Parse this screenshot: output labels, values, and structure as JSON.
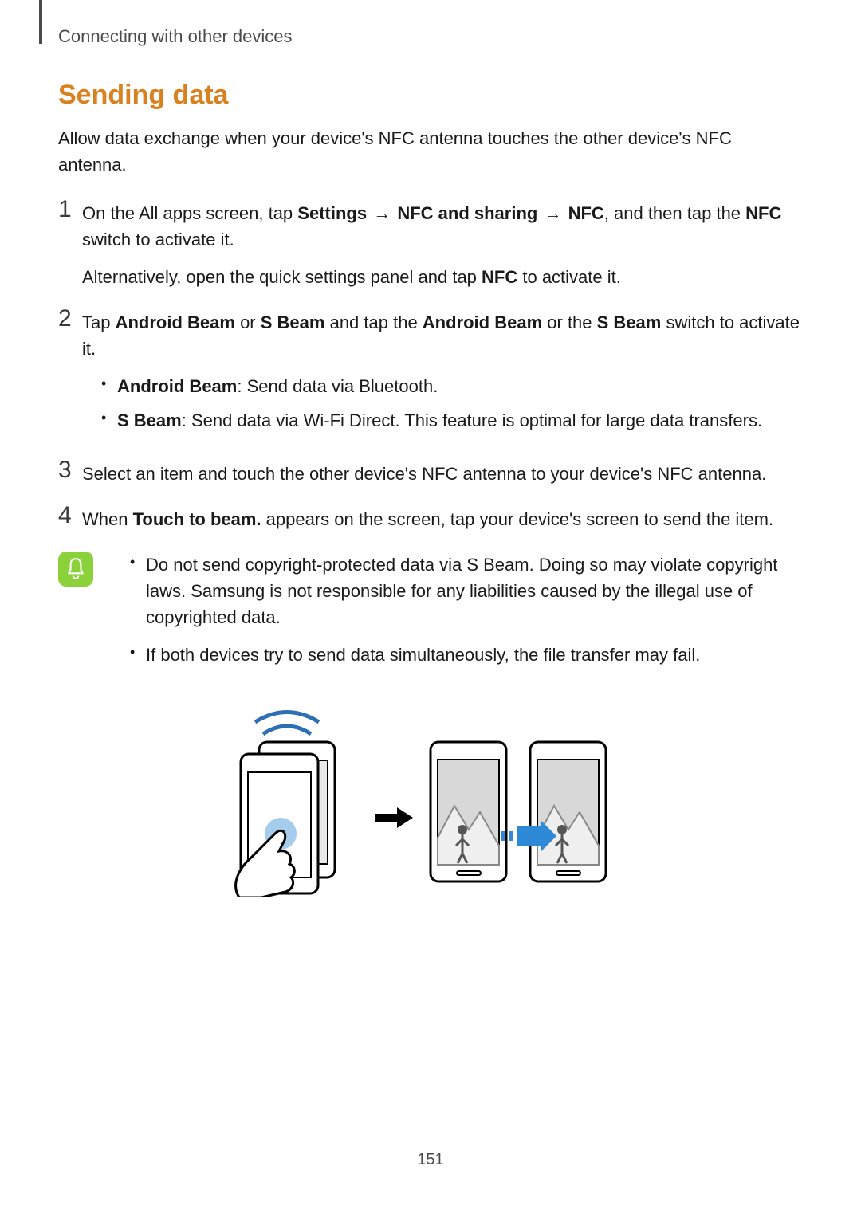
{
  "header": {
    "running_title": "Connecting with other devices"
  },
  "section": {
    "title": "Sending data",
    "intro": "Allow data exchange when your device's NFC antenna touches the other device's NFC antenna."
  },
  "steps": [
    {
      "num": "1",
      "parts": {
        "a_pre": "On the All apps screen, tap ",
        "a_b1": "Settings",
        "a_arrow1": " → ",
        "a_b2": "NFC and sharing",
        "a_arrow2": " → ",
        "a_b3": "NFC",
        "a_mid": ", and then tap the ",
        "a_b4": "NFC",
        "a_post": " switch to activate it."
      },
      "alt": {
        "pre": "Alternatively, open the quick settings panel and tap ",
        "b": "NFC",
        "post": " to activate it."
      }
    },
    {
      "num": "2",
      "parts": {
        "pre": "Tap ",
        "b1": "Android Beam",
        "or1": " or ",
        "b2": "S Beam",
        "mid": " and tap the ",
        "b3": "Android Beam",
        "or2": " or the ",
        "b4": "S Beam",
        "post": " switch to activate it."
      },
      "bullets": [
        {
          "b": "Android Beam",
          "t": ": Send data via Bluetooth."
        },
        {
          "b": "S Beam",
          "t": ": Send data via Wi-Fi Direct. This feature is optimal for large data transfers."
        }
      ]
    },
    {
      "num": "3",
      "text": "Select an item and touch the other device's NFC antenna to your device's NFC antenna."
    },
    {
      "num": "4",
      "parts": {
        "pre": "When ",
        "b": "Touch to beam.",
        "post": " appears on the screen, tap your device's screen to send the item."
      }
    }
  ],
  "notes": [
    "Do not send copyright-protected data via S Beam. Doing so may violate copyright laws. Samsung is not responsible for any liabilities caused by the illegal use of copyrighted data.",
    "If both devices try to send data simultaneously, the file transfer may fail."
  ],
  "page_number": "151"
}
